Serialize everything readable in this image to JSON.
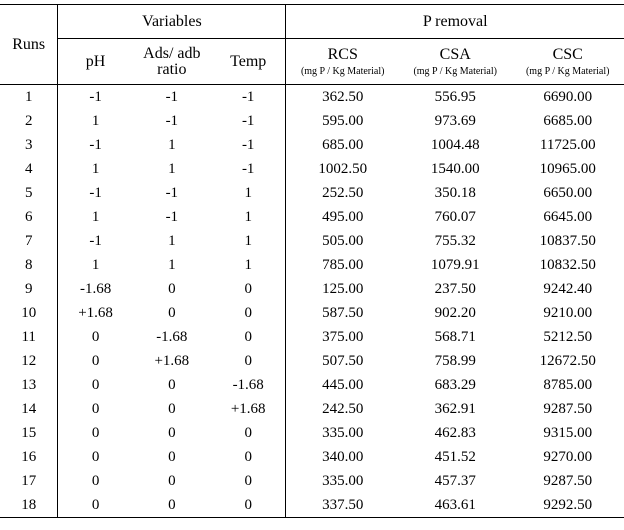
{
  "chart_data": {
    "type": "table",
    "title": "",
    "columns": [
      "Runs",
      "pH",
      "Ads/ adb ratio",
      "Temp",
      "RCS (mg P / Kg Material)",
      "CSA (mg P / Kg Material)",
      "CSC (mg P / Kg Material)"
    ],
    "rows": [
      {
        "run": "1",
        "ph": "-1",
        "ads": "-1",
        "temp": "-1",
        "rcs": "362.50",
        "csa": "556.95",
        "csc": "6690.00"
      },
      {
        "run": "2",
        "ph": "1",
        "ads": "-1",
        "temp": "-1",
        "rcs": "595.00",
        "csa": "973.69",
        "csc": "6685.00"
      },
      {
        "run": "3",
        "ph": "-1",
        "ads": "1",
        "temp": "-1",
        "rcs": "685.00",
        "csa": "1004.48",
        "csc": "11725.00"
      },
      {
        "run": "4",
        "ph": "1",
        "ads": "1",
        "temp": "-1",
        "rcs": "1002.50",
        "csa": "1540.00",
        "csc": "10965.00",
        "bold": [
          "rcs",
          "csa"
        ]
      },
      {
        "run": "5",
        "ph": "-1",
        "ads": "-1",
        "temp": "1",
        "rcs": "252.50",
        "csa": "350.18",
        "csc": "6650.00"
      },
      {
        "run": "6",
        "ph": "1",
        "ads": "-1",
        "temp": "1",
        "rcs": "495.00",
        "csa": "760.07",
        "csc": "6645.00"
      },
      {
        "run": "7",
        "ph": "-1",
        "ads": "1",
        "temp": "1",
        "rcs": "505.00",
        "csa": "755.32",
        "csc": "10837.50"
      },
      {
        "run": "8",
        "ph": "1",
        "ads": "1",
        "temp": "1",
        "rcs": "785.00",
        "csa": "1079.91",
        "csc": "10832.50"
      },
      {
        "run": "9",
        "ph": "-1.68",
        "ads": "0",
        "temp": "0",
        "rcs": "125.00",
        "csa": "237.50",
        "csc": "9242.40",
        "bold": [
          "rcs",
          "csa"
        ]
      },
      {
        "run": "10",
        "ph": "+1.68",
        "ads": "0",
        "temp": "0",
        "rcs": "587.50",
        "csa": "902.20",
        "csc": "9210.00"
      },
      {
        "run": "11",
        "ph": "0",
        "ads": "-1.68",
        "temp": "0",
        "rcs": "375.00",
        "csa": "568.71",
        "csc": "5212.50",
        "bold": [
          "csc"
        ]
      },
      {
        "run": "12",
        "ph": "0",
        "ads": "+1.68",
        "temp": "0",
        "rcs": "507.50",
        "csa": "758.99",
        "csc": "12672.50",
        "bold": [
          "csc"
        ]
      },
      {
        "run": "13",
        "ph": "0",
        "ads": "0",
        "temp": "-1.68",
        "rcs": "445.00",
        "csa": "683.29",
        "csc": "8785.00"
      },
      {
        "run": "14",
        "ph": "0",
        "ads": "0",
        "temp": "+1.68",
        "rcs": "242.50",
        "csa": "362.91",
        "csc": "9287.50"
      },
      {
        "run": "15",
        "ph": "0",
        "ads": "0",
        "temp": "0",
        "rcs": "335.00",
        "csa": "462.83",
        "csc": "9315.00"
      },
      {
        "run": "16",
        "ph": "0",
        "ads": "0",
        "temp": "0",
        "rcs": "340.00",
        "csa": "451.52",
        "csc": "9270.00"
      },
      {
        "run": "17",
        "ph": "0",
        "ads": "0",
        "temp": "0",
        "rcs": "335.00",
        "csa": "457.37",
        "csc": "9287.50"
      },
      {
        "run": "18",
        "ph": "0",
        "ads": "0",
        "temp": "0",
        "rcs": "337.50",
        "csa": "463.61",
        "csc": "9292.50"
      }
    ]
  },
  "headers": {
    "runs": "Runs",
    "variables": "Variables",
    "premoval": "P removal",
    "ph": "pH",
    "ads_line1": "Ads/ adb",
    "ads_line2": "ratio",
    "temp": "Temp",
    "rcs": "RCS",
    "csa": "CSA",
    "csc": "CSC",
    "unit": "(mg P / Kg Material)"
  }
}
